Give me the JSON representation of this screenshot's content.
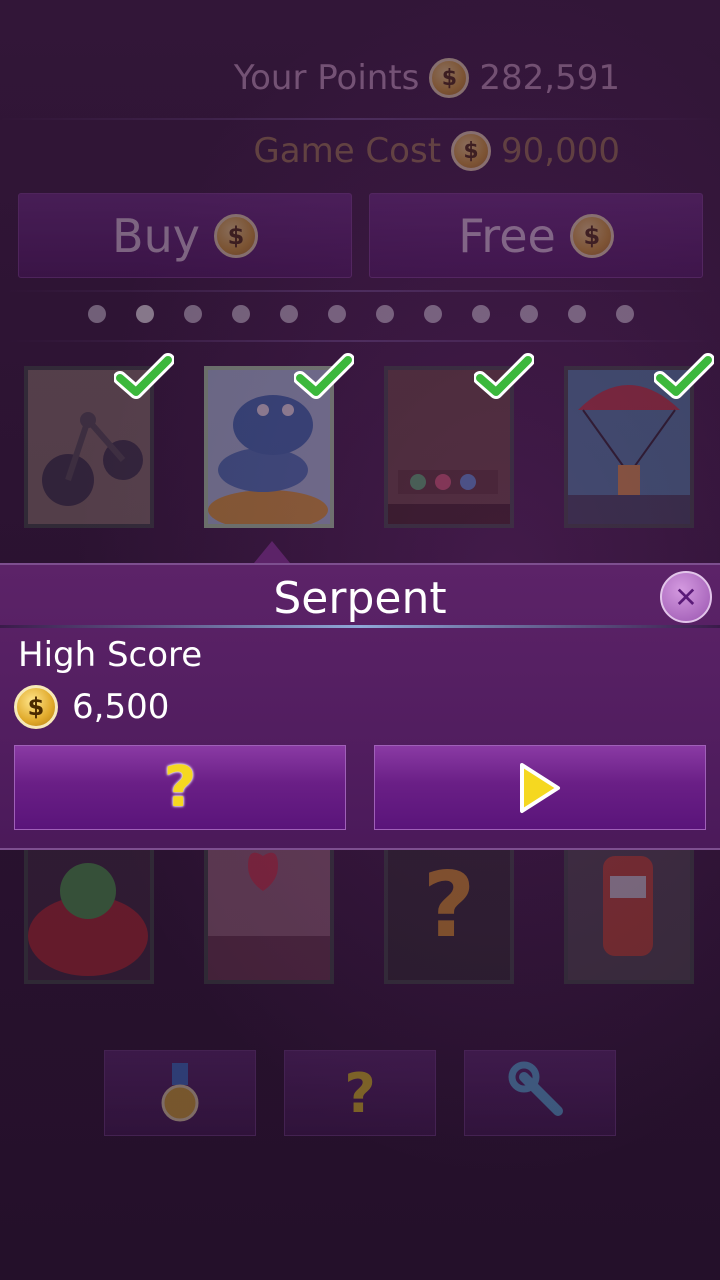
{
  "header": {
    "your_points_label": "Your Points",
    "your_points_value": "282,591",
    "game_cost_label": "Game Cost",
    "game_cost_value": "90,000"
  },
  "buttons": {
    "buy_label": "Buy",
    "free_label": "Free"
  },
  "pager": {
    "count": 12,
    "active_index": 1
  },
  "games_row1": [
    {
      "name": "yarn",
      "owned": true
    },
    {
      "name": "serpent",
      "owned": true,
      "selected": true
    },
    {
      "name": "temple",
      "owned": true
    },
    {
      "name": "parachute",
      "owned": true
    }
  ],
  "games_row2": [
    {
      "name": "dino"
    },
    {
      "name": "love"
    },
    {
      "name": "mystery"
    },
    {
      "name": "racer"
    }
  ],
  "popup": {
    "title": "Serpent",
    "high_score_label": "High Score",
    "high_score_value": "6,500"
  },
  "icons": {
    "coin": "$",
    "help": "?",
    "close": "✕"
  },
  "colors": {
    "accent_purple": "#6a1f86",
    "check_green": "#3cb83c",
    "coin_gold": "#e0a92a"
  }
}
